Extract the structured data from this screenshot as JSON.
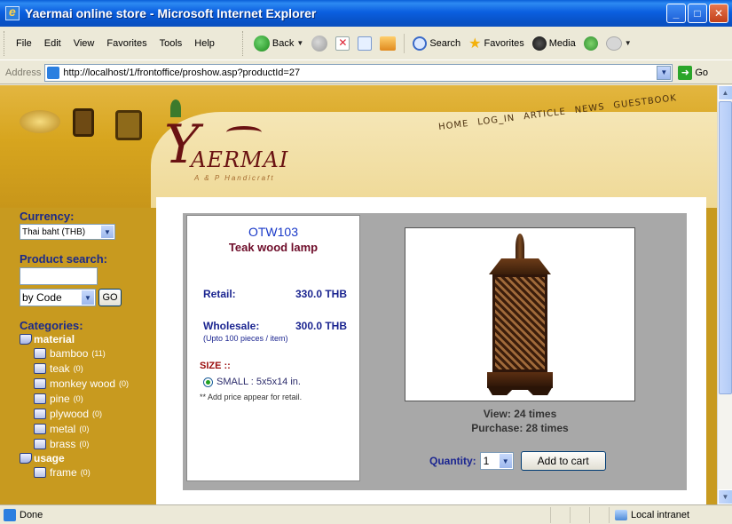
{
  "window": {
    "title": "Yaermai online store - Microsoft Internet Explorer",
    "controls": [
      "_",
      "□",
      "✕"
    ]
  },
  "menu": {
    "items": [
      "File",
      "Edit",
      "View",
      "Favorites",
      "Tools",
      "Help"
    ],
    "toolbar": {
      "back": "Back",
      "search": "Search",
      "favorites": "Favorites",
      "media": "Media"
    }
  },
  "address": {
    "label": "Address",
    "url": "http://localhost/1/frontoffice/proshow.asp?productId=27",
    "go": "Go"
  },
  "site": {
    "logo_y": "Y",
    "logo_rest": "AERMAI",
    "logo_sub": "A & P Handicraft",
    "nav": [
      "HOME",
      "LOG_IN",
      "ARTICLE",
      "NEWS",
      "GUESTBOOK"
    ]
  },
  "sidebar": {
    "currency_heading": "Currency:",
    "currency_value": "Thai baht (THB)",
    "search_heading": "Product search:",
    "search_by": "by Code",
    "go_label": "GO",
    "categories_heading": "Categories:",
    "groups": [
      {
        "name": "material",
        "items": [
          {
            "label": "bamboo",
            "count": "(11)"
          },
          {
            "label": "teak",
            "count": "(0)"
          },
          {
            "label": "monkey wood",
            "count": "(0)"
          },
          {
            "label": "pine",
            "count": "(0)"
          },
          {
            "label": "plywood",
            "count": "(0)"
          },
          {
            "label": "metal",
            "count": "(0)"
          },
          {
            "label": "brass",
            "count": "(0)"
          }
        ]
      },
      {
        "name": "usage",
        "items": [
          {
            "label": "frame",
            "count": "(0)"
          }
        ]
      }
    ]
  },
  "product": {
    "code": "OTW103",
    "name": "Teak wood lamp",
    "retail_label": "Retail:",
    "retail_price": "330.0 THB",
    "wholesale_label": "Wholesale:",
    "wholesale_price": "300.0 THB",
    "wholesale_note": "(Upto 100 pieces / item)",
    "size_label": "SIZE ::",
    "size_option": "SMALL : 5x5x14 in.",
    "price_note": "** Add price appear for retail.",
    "views": "View: 24 times",
    "purchases": "Purchase: 28 times",
    "quantity_label": "Quantity:",
    "quantity_value": "1",
    "add_to_cart": "Add to cart"
  },
  "status": {
    "text": "Done",
    "zone": "Local intranet"
  }
}
